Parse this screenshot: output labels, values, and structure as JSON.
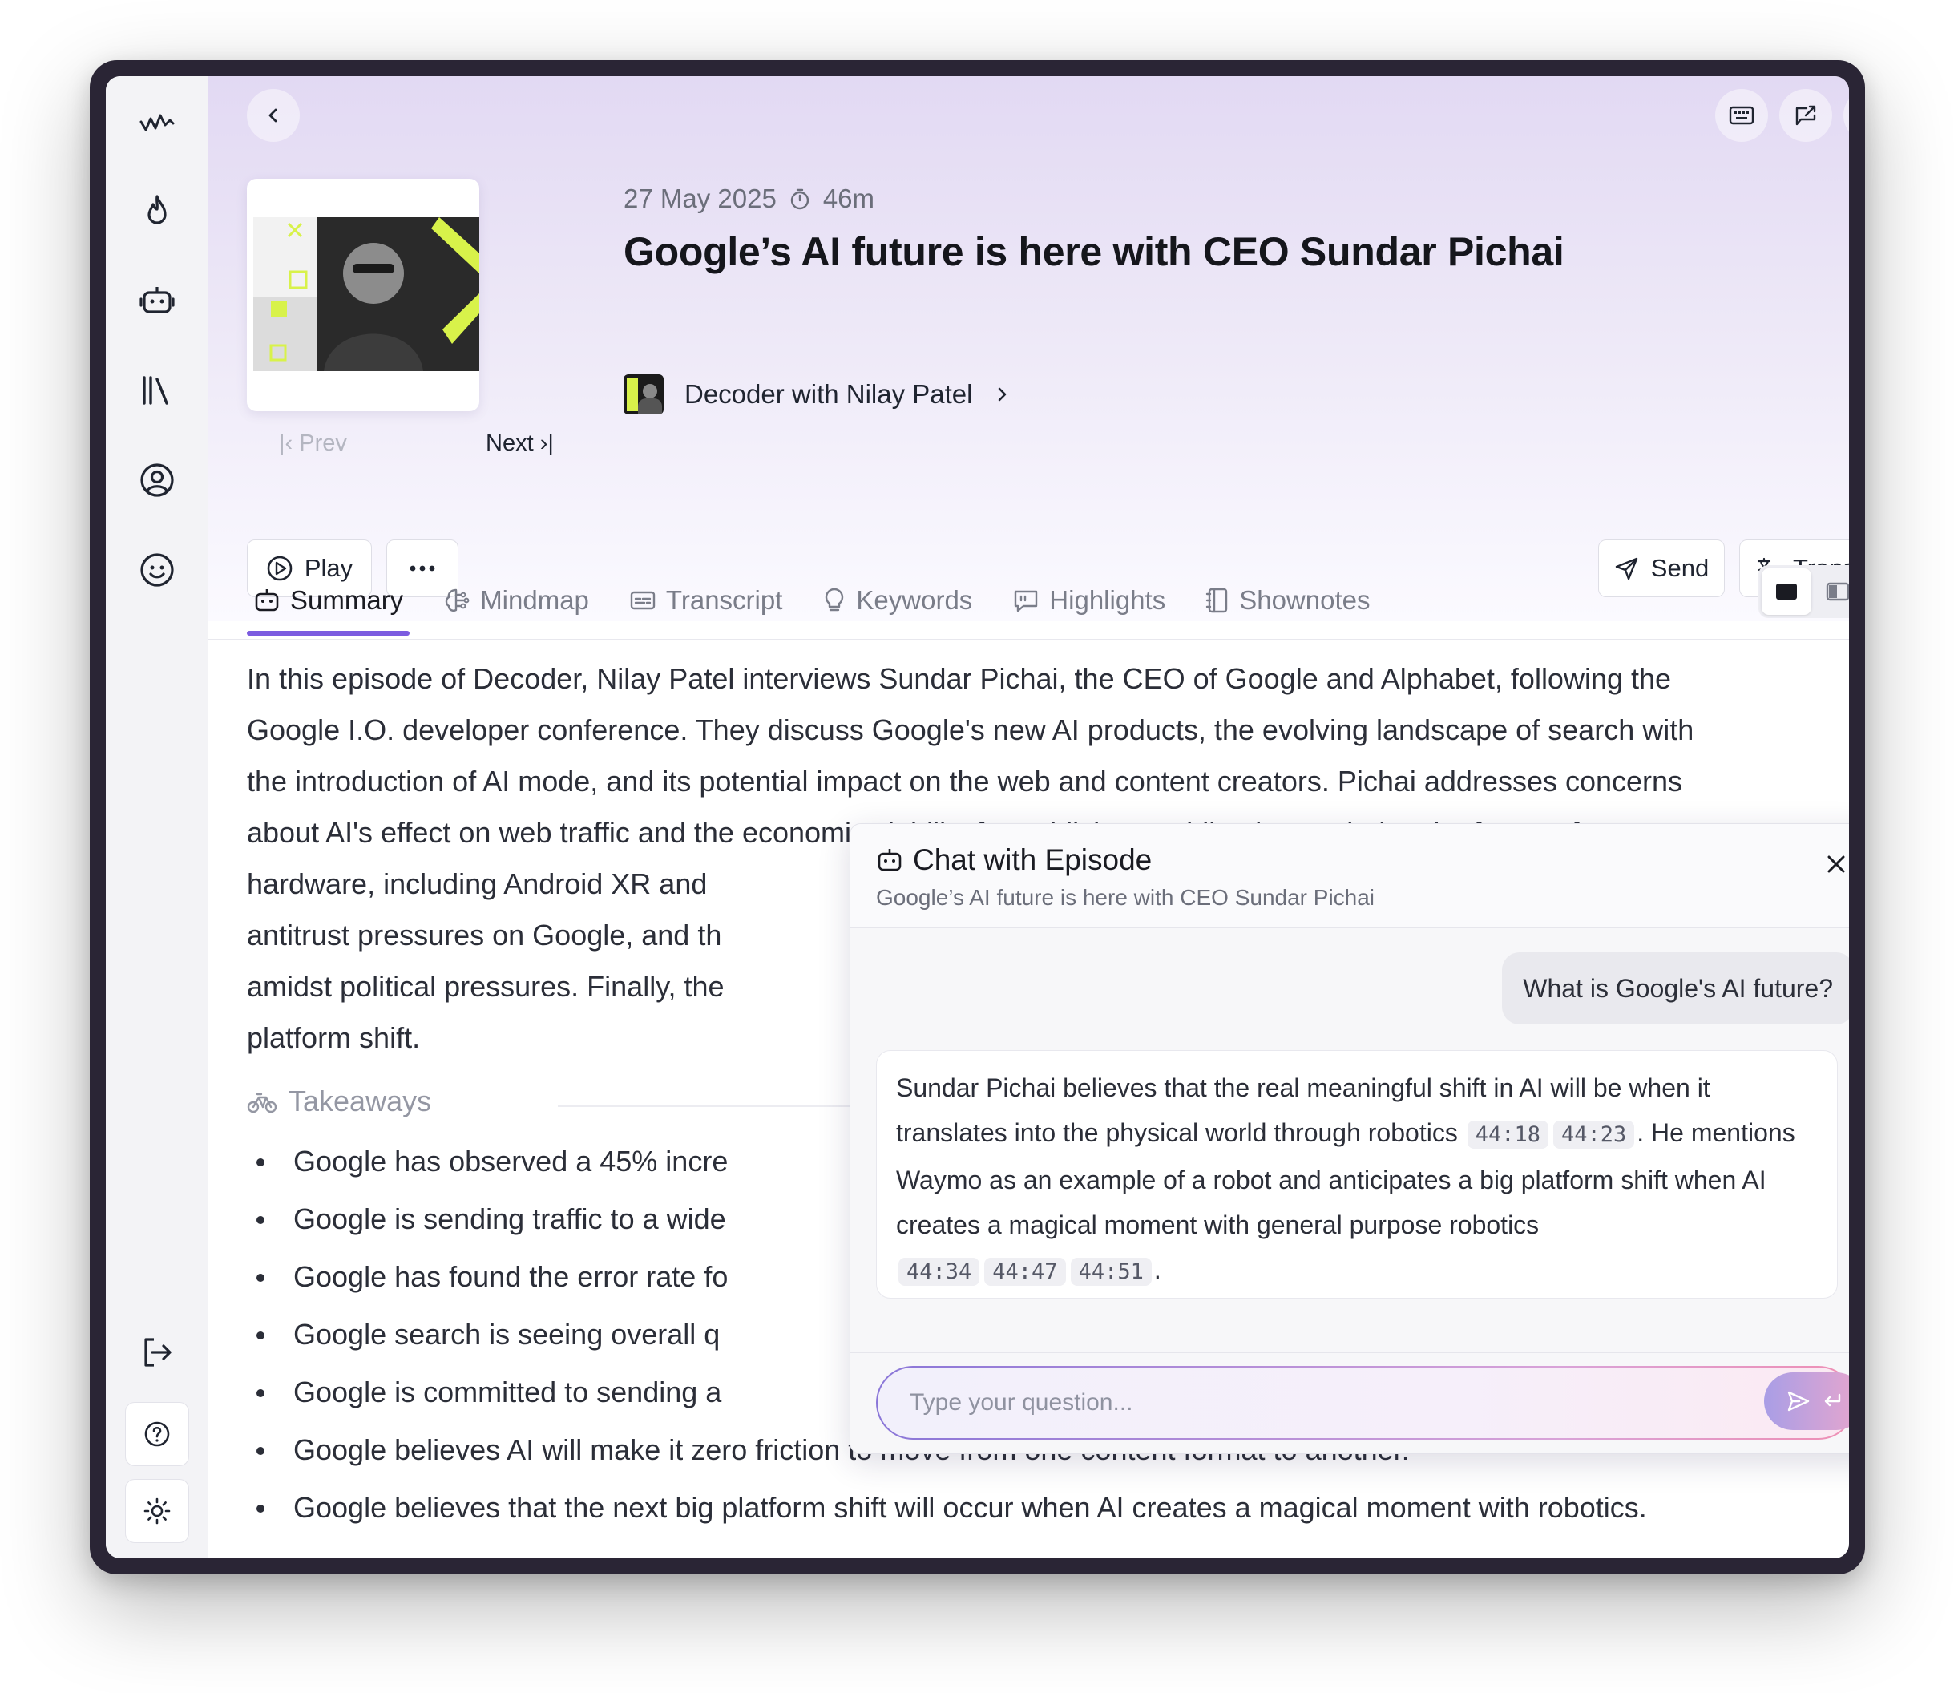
{
  "episode": {
    "date": "27 May 2025",
    "duration": "46m",
    "title": "Google’s AI future is here with CEO Sundar Pichai",
    "podcast_name": "Decoder with Nilay Patel"
  },
  "navigation": {
    "prev_label": "Prev",
    "next_label": "Next"
  },
  "actions": {
    "play_label": "Play",
    "send_label": "Send",
    "translate_label": "Translate"
  },
  "tabs": [
    {
      "label": "Summary",
      "icon": "robot-icon",
      "active": true
    },
    {
      "label": "Mindmap",
      "icon": "brain-icon",
      "active": false
    },
    {
      "label": "Transcript",
      "icon": "captions-icon",
      "active": false
    },
    {
      "label": "Keywords",
      "icon": "lightbulb-icon",
      "active": false
    },
    {
      "label": "Highlights",
      "icon": "quote-icon",
      "active": false
    },
    {
      "label": "Shownotes",
      "icon": "notebook-icon",
      "active": false
    }
  ],
  "summary": {
    "text": "In this episode of Decoder, Nilay Patel interviews Sundar Pichai, the CEO of Google and Alphabet, following the Google I.O. developer conference. They discuss Google's new AI products, the evolving landscape of search with the introduction of AI mode, and its potential impact on the web and content creators. Pichai addresses concerns about AI's effect on web traffic and the economic viability for publishers, while also exploring the future of hardware, including Android XR and antitrust pressures on Google, and amidst political pressures. Finally, the platform shift.",
    "lines": [
      "In this episode of Decoder, Nilay Patel interviews Sundar Pichai, the CEO of Google and Alphabet, following the",
      "Google I.O. developer conference. They discuss Google's new AI products, the evolving landscape of search with",
      "the introduction of AI mode, and its potential impact on the web and content creators. Pichai addresses concerns",
      "about AI's effect on web traffic and the economic viability for publishers, while also exploring the future of",
      "hardware, including Android XR and",
      "antitrust pressures on Google, and th",
      "amidst political pressures. Finally, the",
      "platform shift."
    ]
  },
  "takeaways": {
    "heading": "Takeaways",
    "items": [
      "Google has observed a 45% incre",
      "Google is sending traffic to a wide",
      "Google has found the error rate fo",
      "Google search is seeing overall q",
      "Google is committed to sending a",
      "Google believes AI will make it zero friction to move from one content format to another.",
      "Google believes that the next big platform shift will occur when AI creates a magical moment with robotics."
    ]
  },
  "chat": {
    "title": "Chat with Episode",
    "subtitle": "Google’s AI future is here with CEO Sundar Pichai",
    "question": "What is Google's AI future?",
    "answer": {
      "part1": "Sundar Pichai believes that the real meaningful shift in AI will be when it translates into the physical world through robotics",
      "ts1": "44:18",
      "ts2": "44:23",
      "part2": ". He mentions Waymo as an example of a robot and anticipates a big platform shift when AI creates a magical moment with general purpose robotics",
      "ts3": "44:34",
      "ts4": "44:47",
      "ts5": "44:51",
      "part3": "."
    },
    "input_placeholder": "Type your question..."
  },
  "colors": {
    "accent": "#7c5ce0",
    "fab": "#14171f"
  }
}
